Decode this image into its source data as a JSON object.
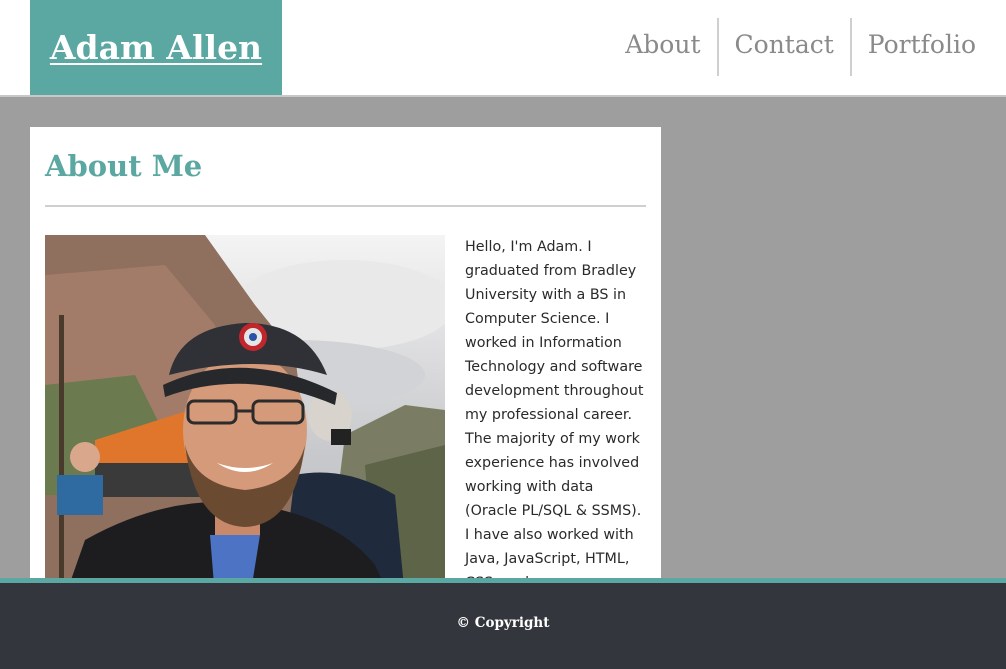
{
  "header": {
    "site_title": "Adam Allen",
    "nav": [
      {
        "label": "About"
      },
      {
        "label": "Contact"
      },
      {
        "label": "Portfolio"
      }
    ]
  },
  "main": {
    "section_title": "About Me",
    "bio": "Hello, I'm Adam. I graduated from Bradley University with a BS in Computer Science. I worked in Information Technology and software development throughout my professional career. The majority of my work experience has involved working with data (Oracle PL/SQL & SSMS). I have also worked with Java, JavaScript, HTML, CSS, and more."
  },
  "footer": {
    "copyright": "© Copyright"
  },
  "colors": {
    "accent": "#5ba7a2",
    "page_background": "#9e9e9e",
    "footer_background": "#33363d",
    "nav_text": "#8a8a8a"
  }
}
